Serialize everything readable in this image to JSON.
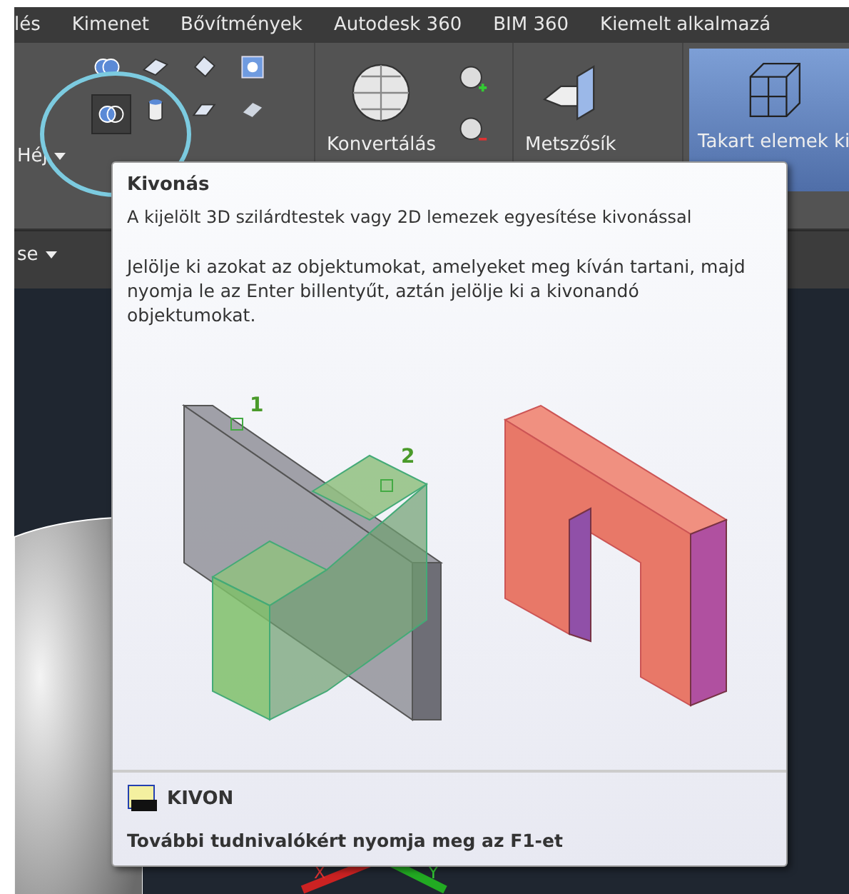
{
  "menu_tabs": [
    "lés",
    "Kimenet",
    "Bővítmények",
    "Autodesk 360",
    "BIM 360",
    "Kiemelt alkalmazá"
  ],
  "ribbon": {
    "dropdown_label": "Héj",
    "panel_label": "se",
    "highlighted_tool": true,
    "big_buttons": [
      {
        "kind": "convert",
        "label": "Konvertálás",
        "on": false
      },
      {
        "kind": "section",
        "label": "Metszősík",
        "on": false
      },
      {
        "kind": "hidden",
        "label": "Takart elemek ki",
        "on": true
      }
    ]
  },
  "tooltip": {
    "title": "Kivonás",
    "description": "A kijelölt 3D szilárdtestek vagy 2D lemezek egyesítése kivonással",
    "instructions": "Jelölje ki azokat az objektumokat, amelyeket meg kíván tartani, majd nyomja le az Enter billentyűt, aztán jelölje ki a kivonandó objektumokat.",
    "callouts": [
      "1",
      "2"
    ],
    "command": "KIVON",
    "help": "További tudnivalókért nyomja meg az F1-et"
  },
  "viewport": {
    "axis_labels": [
      "X",
      "Y"
    ]
  }
}
